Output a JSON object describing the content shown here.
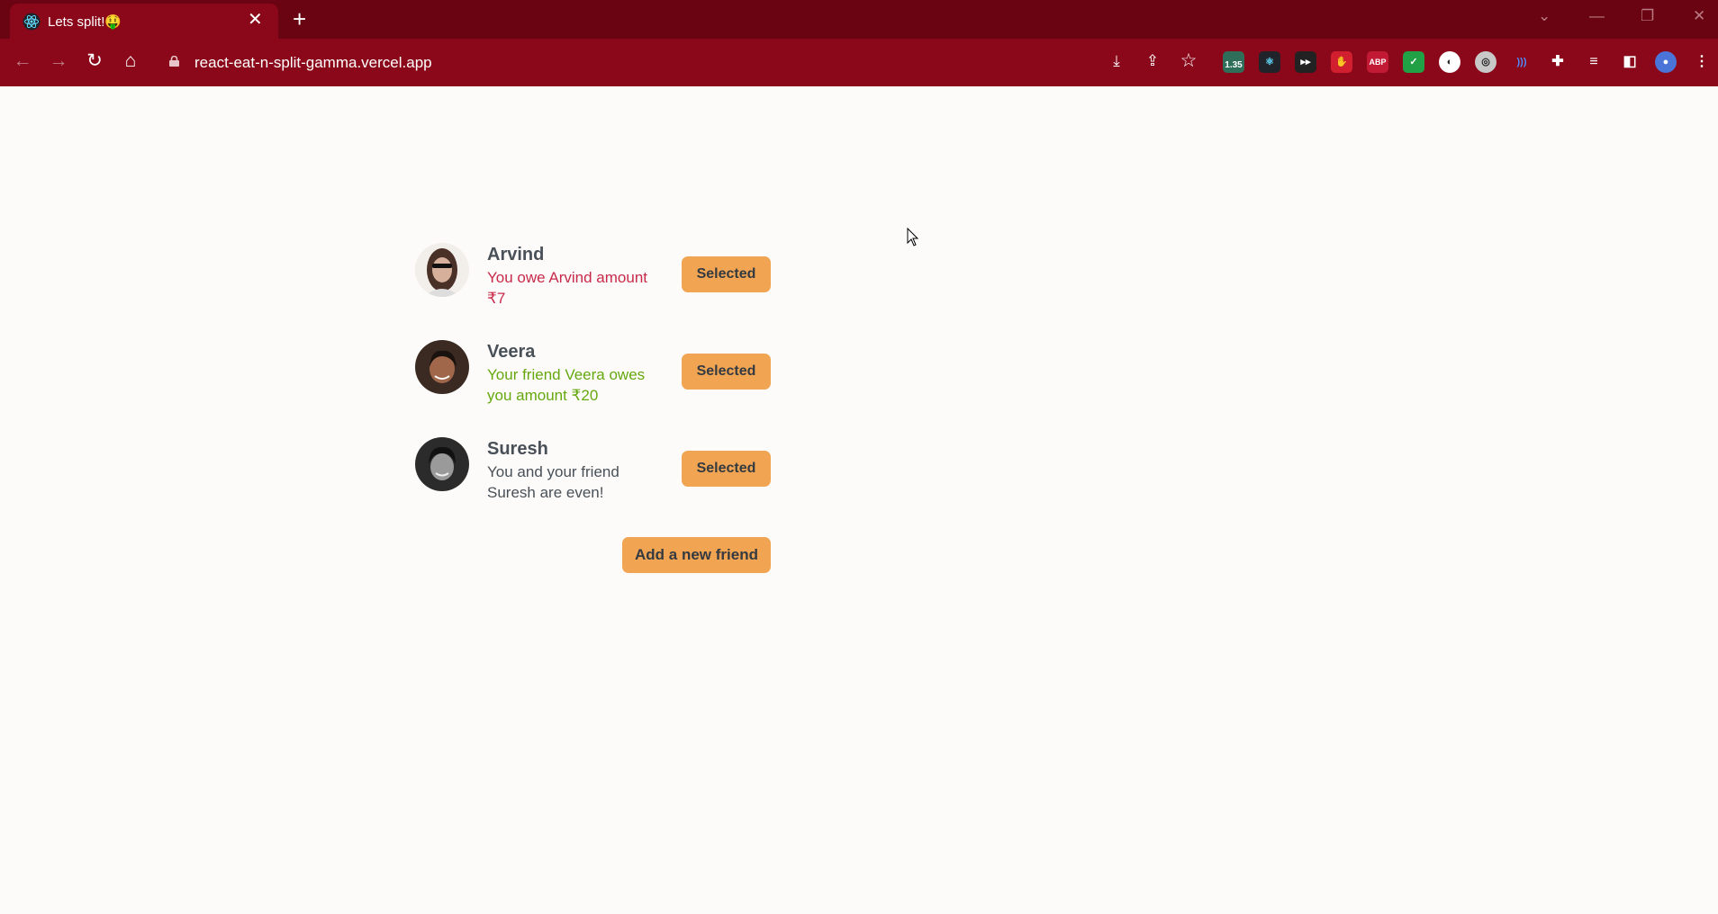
{
  "browser": {
    "tab_title": "Lets split!🤑",
    "url": "react-eat-n-split-gamma.vercel.app",
    "extension_badge": "1.35",
    "abp_label": "ABP"
  },
  "friends": [
    {
      "name": "Arvind",
      "message": "You owe Arvind amount ₹7",
      "balance": -7,
      "button": "Selected"
    },
    {
      "name": "Veera",
      "message": "Your friend Veera owes you amount ₹20",
      "balance": 20,
      "button": "Selected"
    },
    {
      "name": "Suresh",
      "message": "You and your friend Suresh are even!",
      "balance": 0,
      "button": "Selected"
    }
  ],
  "add_friend_label": "Add a new friend",
  "colors": {
    "accent": "#f1a553",
    "owe": "#c92a4a",
    "owed": "#66a80f",
    "chrome": "#8a0819"
  }
}
